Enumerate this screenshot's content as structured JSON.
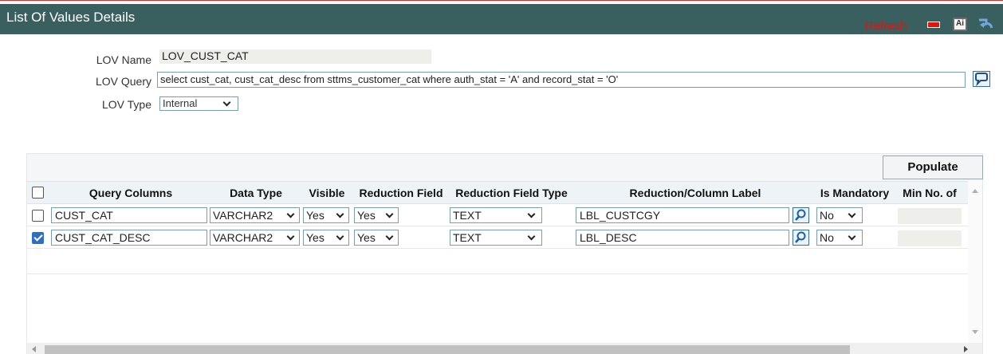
{
  "window": {
    "title": "List Of Values Details",
    "refresh_label": "Refresh"
  },
  "form": {
    "lov_name_label": "LOV Name",
    "lov_name_value": "LOV_CUST_CAT",
    "lov_query_label": "LOV Query",
    "lov_query_value": "select cust_cat, cust_cat_desc from sttms_customer_cat where auth_stat = 'A' and record_stat = 'O'",
    "lov_type_label": "LOV Type",
    "lov_type_value": "Internal"
  },
  "grid": {
    "populate_label": "Populate",
    "columns": [
      "Query Columns",
      "Data Type",
      "Visible",
      "Reduction Field",
      "Reduction Field Type",
      "Reduction/Column Label",
      "Is Mandatory",
      "Min No. of"
    ],
    "rows": [
      {
        "checked": false,
        "query_column": "CUST_CAT",
        "data_type": "VARCHAR2",
        "visible": "Yes",
        "reduction_field": "Yes",
        "reduction_field_type": "TEXT",
        "label": "LBL_CUSTCGY",
        "is_mandatory": "No"
      },
      {
        "checked": true,
        "query_column": "CUST_CAT_DESC",
        "data_type": "VARCHAR2",
        "visible": "Yes",
        "reduction_field": "Yes",
        "reduction_field_type": "TEXT",
        "label": "LBL_DESC",
        "is_mandatory": "No"
      }
    ]
  },
  "colors": {
    "titlebar_bg": "#3a5f5f",
    "refresh_text": "#e8120c",
    "checkbox_checked": "#2d6fc7"
  }
}
